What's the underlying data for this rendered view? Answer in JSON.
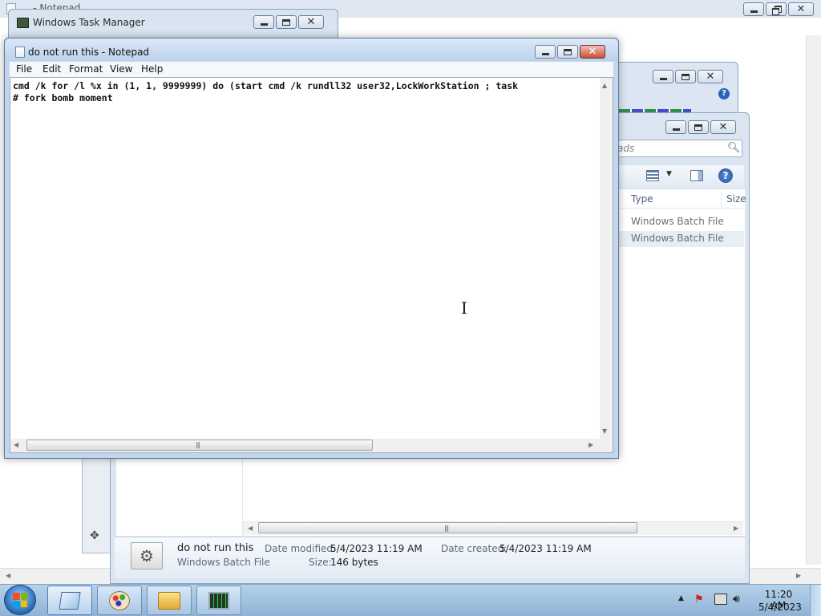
{
  "background_window": {
    "title": "... - Notepad"
  },
  "task_manager": {
    "title": "Windows Task Manager"
  },
  "notepad": {
    "title": "do not run this - Notepad",
    "menu": [
      "File",
      "Edit",
      "Format",
      "View",
      "Help"
    ],
    "lines": [
      "cmd /k for /l %x in (1, 1, 9999999) do (start cmd /k rundll32 user32,LockWorkStation ; task",
      "# fork bomb moment"
    ]
  },
  "explorer": {
    "search_placeholder": "ads",
    "columns": {
      "type": "Type",
      "size": "Size"
    },
    "rows": [
      {
        "type": "Windows Batch File"
      },
      {
        "type": "Windows Batch File"
      }
    ],
    "details": {
      "file_name": "do not run this",
      "file_type": "Windows Batch File",
      "modified_label": "Date modified:",
      "modified_value": "5/4/2023 11:19 AM",
      "created_label": "Date created:",
      "created_value": "5/4/2023 11:19 AM",
      "size_label": "Size:",
      "size_value": "146 bytes"
    }
  },
  "taskbar": {
    "pinned": [
      {
        "icon": "notepad-icon"
      },
      {
        "icon": "paint-icon"
      },
      {
        "icon": "folder-icon"
      },
      {
        "icon": "task-manager-icon"
      }
    ],
    "clock": {
      "time": "11:20 AM",
      "date": "5/4/2023"
    }
  },
  "colors": {
    "taskbar": "#9dbde0",
    "close_button": "#c8513b",
    "window_frame": "#c4d6ec"
  }
}
